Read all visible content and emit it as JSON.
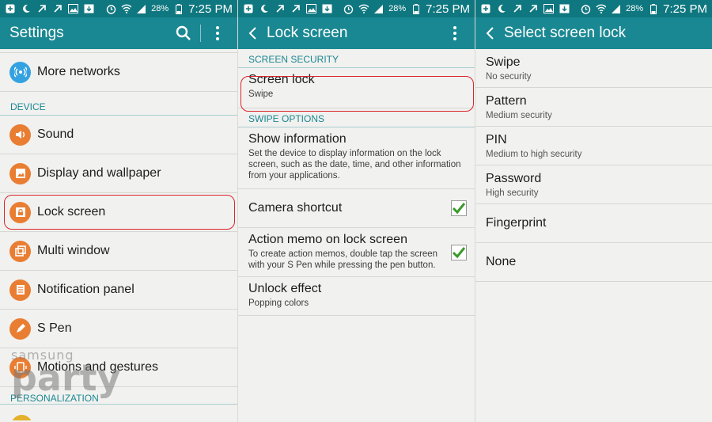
{
  "status_bar": {
    "battery": "28%",
    "time": "7:25 PM"
  },
  "settings_panel": {
    "title": "Settings",
    "top_item": "More networks",
    "device_header": "DEVICE",
    "items": [
      {
        "label": "Sound"
      },
      {
        "label": "Display and wallpaper"
      },
      {
        "label": "Lock screen"
      },
      {
        "label": "Multi window"
      },
      {
        "label": "Notification panel"
      },
      {
        "label": "S Pen"
      },
      {
        "label": "Motions and gestures"
      }
    ],
    "personalization_header": "PERSONALIZATION",
    "watermark": {
      "line1": "samsung",
      "line2": "party"
    }
  },
  "lock_screen_panel": {
    "title": "Lock screen",
    "screen_security_header": "SCREEN SECURITY",
    "screen_lock": {
      "title": "Screen lock",
      "value": "Swipe"
    },
    "swipe_options_header": "SWIPE OPTIONS",
    "show_information": {
      "title": "Show information",
      "desc": "Set the device to display information on the lock screen, such as the date, time, and other information from your applications."
    },
    "camera_shortcut": {
      "title": "Camera shortcut",
      "checked": true
    },
    "action_memo": {
      "title": "Action memo on lock screen",
      "desc": "To create action memos, double tap the screen with your S Pen while pressing the pen button.",
      "checked": true
    },
    "unlock_effect": {
      "title": "Unlock effect",
      "value": "Popping colors"
    }
  },
  "select_lock_panel": {
    "title": "Select screen lock",
    "options": [
      {
        "title": "Swipe",
        "sub": "No security"
      },
      {
        "title": "Pattern",
        "sub": "Medium security"
      },
      {
        "title": "PIN",
        "sub": "Medium to high security"
      },
      {
        "title": "Password",
        "sub": "High security"
      },
      {
        "title": "Fingerprint",
        "sub": ""
      },
      {
        "title": "None",
        "sub": ""
      }
    ]
  },
  "colors": {
    "status_bar": "#0f777f",
    "action_bar": "#1a8892",
    "icon_orange": "#e97e33",
    "icon_blue": "#34a2e0",
    "highlight": "#d8262b",
    "check": "#3a9a2a"
  }
}
